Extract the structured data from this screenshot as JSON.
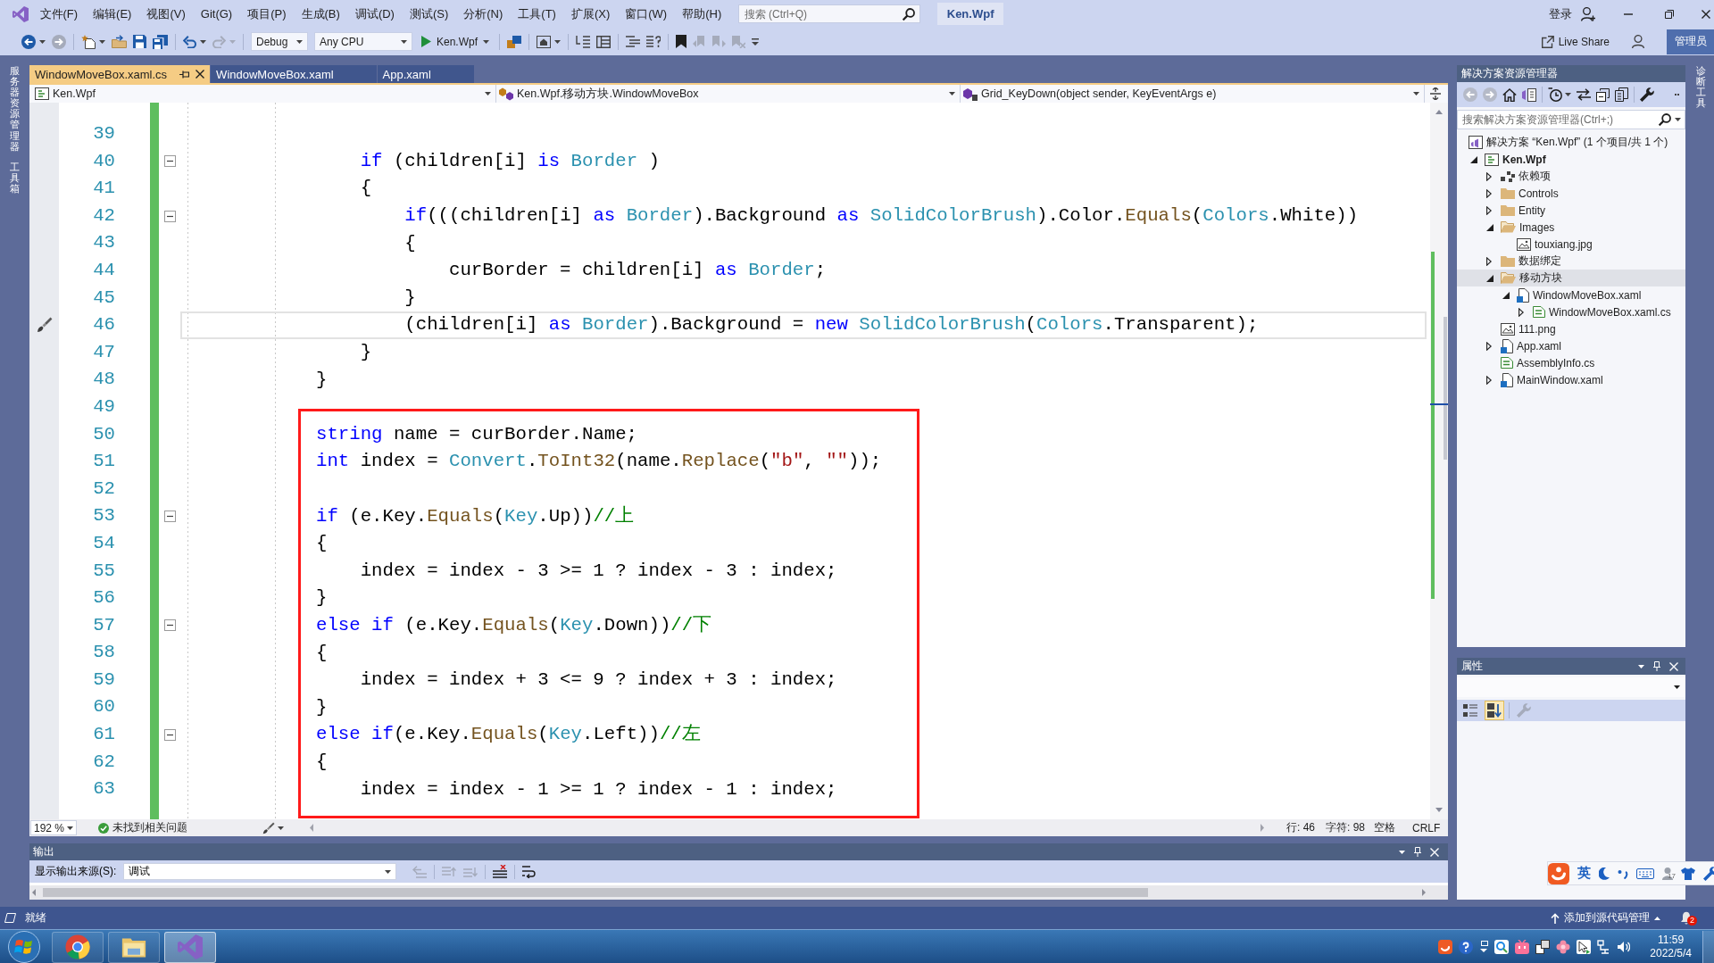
{
  "window": {
    "title": "Ken.Wpf",
    "sign_in": "登录",
    "search": {
      "placeholder": "搜索 (Ctrl+Q)"
    }
  },
  "menu": [
    "文件(F)",
    "编辑(E)",
    "视图(V)",
    "Git(G)",
    "项目(P)",
    "生成(B)",
    "调试(D)",
    "测试(S)",
    "分析(N)",
    "工具(T)",
    "扩展(X)",
    "窗口(W)",
    "帮助(H)"
  ],
  "toolbar": {
    "buttons": [
      {
        "kind": "back",
        "disabled": false
      },
      {
        "kind": "forward",
        "disabled": true
      },
      {
        "kind": "new-item",
        "disabled": false
      },
      {
        "kind": "open",
        "disabled": false
      },
      {
        "kind": "save",
        "disabled": false
      },
      {
        "kind": "save-all",
        "disabled": false
      },
      {
        "kind": "undo",
        "disabled": false
      },
      {
        "kind": "redo",
        "disabled": true
      }
    ],
    "configuration": "Debug",
    "platform": "Any CPU",
    "start": "Ken.Wpf",
    "tools": [
      {
        "kind": "browser-link",
        "disabled": false
      },
      {
        "kind": "window",
        "disabled": false
      },
      {
        "kind": "indent",
        "disabled": false
      },
      {
        "kind": "outdent",
        "disabled": false
      },
      {
        "kind": "comment",
        "disabled": false
      },
      {
        "kind": "uncomment",
        "disabled": false
      },
      {
        "kind": "bookmark",
        "disabled": false
      },
      {
        "kind": "bookmark-previous",
        "disabled": true
      },
      {
        "kind": "bookmark-next",
        "disabled": true
      },
      {
        "kind": "bookmark-clear",
        "disabled": true
      }
    ],
    "live_share": "Live Share",
    "account": "管理员"
  },
  "side_tabs": {
    "left": [
      "服务器资源管理器",
      "工具箱"
    ],
    "right": [
      "诊断工具"
    ]
  },
  "document_tabs": [
    {
      "label": "WindowMoveBox.xaml.cs",
      "selected": true
    },
    {
      "label": "WindowMoveBox.xaml",
      "selected": false
    },
    {
      "label": "App.xaml",
      "selected": false
    }
  ],
  "navigation": {
    "project": "Ken.Wpf",
    "type": "Ken.Wpf.移动方块.WindowMoveBox",
    "member": "Grid_KeyDown(object sender, KeyEventArgs e)"
  },
  "editor": {
    "lines": [
      {
        "number": "39",
        "current": false
      },
      {
        "number": "40",
        "current": false,
        "expanded": true,
        "tokens": [
          {
            "kind": "keyword",
            "text": "    if"
          },
          {
            "kind": "plain",
            "text": " (children[i] "
          },
          {
            "kind": "keyword",
            "text": "is "
          },
          {
            "kind": "type",
            "text": "Border"
          },
          {
            "kind": "plain",
            "text": " )"
          }
        ]
      },
      {
        "number": "41",
        "current": false,
        "tokens": [
          {
            "kind": "plain",
            "text": "    {"
          }
        ]
      },
      {
        "number": "42",
        "current": false,
        "expanded": true,
        "tokens": [
          {
            "kind": "keyword",
            "text": "        if"
          },
          {
            "kind": "plain",
            "text": "(((children[i] "
          },
          {
            "kind": "keyword",
            "text": "as "
          },
          {
            "kind": "type",
            "text": "Border"
          },
          {
            "kind": "plain",
            "text": ").Background "
          },
          {
            "kind": "keyword",
            "text": "as "
          },
          {
            "kind": "type",
            "text": "SolidColorBrush"
          },
          {
            "kind": "plain",
            "text": ").Color."
          },
          {
            "kind": "method",
            "text": "Equals"
          },
          {
            "kind": "plain",
            "text": "("
          },
          {
            "kind": "type",
            "text": "Colors"
          },
          {
            "kind": "plain",
            "text": ".White))"
          }
        ]
      },
      {
        "number": "43",
        "current": false,
        "tokens": [
          {
            "kind": "plain",
            "text": "        {"
          }
        ]
      },
      {
        "number": "44",
        "current": false,
        "tokens": [
          {
            "kind": "plain",
            "text": "            curBorder = children[i] "
          },
          {
            "kind": "keyword",
            "text": "as "
          },
          {
            "kind": "type",
            "text": "Border"
          },
          {
            "kind": "plain",
            "text": ";"
          }
        ]
      },
      {
        "number": "45",
        "current": false,
        "tokens": [
          {
            "kind": "plain",
            "text": "        }"
          }
        ]
      },
      {
        "number": "46",
        "current": true,
        "tokens": [
          {
            "kind": "plain",
            "text": "        (children[i] "
          },
          {
            "kind": "keyword",
            "text": "as "
          },
          {
            "kind": "type",
            "text": "Border"
          },
          {
            "kind": "plain",
            "text": ").Background = "
          },
          {
            "kind": "keyword",
            "text": "new "
          },
          {
            "kind": "type",
            "text": "SolidColorBrush"
          },
          {
            "kind": "plain",
            "text": "("
          },
          {
            "kind": "type",
            "text": "Colors"
          },
          {
            "kind": "plain",
            "text": ".Transparent);"
          }
        ]
      },
      {
        "number": "47",
        "current": false,
        "tokens": [
          {
            "kind": "plain",
            "text": "    }"
          }
        ]
      },
      {
        "number": "48",
        "current": false,
        "tokens": [
          {
            "kind": "plain",
            "text": "}"
          }
        ]
      },
      {
        "number": "49",
        "current": false
      },
      {
        "number": "50",
        "current": false,
        "tokens": [
          {
            "kind": "keyword",
            "text": "string"
          },
          {
            "kind": "plain",
            "text": " name = curBorder.Name;"
          }
        ]
      },
      {
        "number": "51",
        "current": false,
        "tokens": [
          {
            "kind": "keyword",
            "text": "int"
          },
          {
            "kind": "plain",
            "text": " index = "
          },
          {
            "kind": "type",
            "text": "Convert"
          },
          {
            "kind": "plain",
            "text": "."
          },
          {
            "kind": "method",
            "text": "ToInt32"
          },
          {
            "kind": "plain",
            "text": "(name."
          },
          {
            "kind": "method",
            "text": "Replace"
          },
          {
            "kind": "plain",
            "text": "("
          },
          {
            "kind": "string",
            "text": "\"b\""
          },
          {
            "kind": "plain",
            "text": ", "
          },
          {
            "kind": "string",
            "text": "\"\""
          },
          {
            "kind": "plain",
            "text": "));"
          }
        ]
      },
      {
        "number": "52",
        "current": false
      },
      {
        "number": "53",
        "current": false,
        "expanded": true,
        "tokens": [
          {
            "kind": "keyword",
            "text": "if"
          },
          {
            "kind": "plain",
            "text": " (e.Key."
          },
          {
            "kind": "method",
            "text": "Equals"
          },
          {
            "kind": "plain",
            "text": "("
          },
          {
            "kind": "type",
            "text": "Key"
          },
          {
            "kind": "plain",
            "text": ".Up))"
          },
          {
            "kind": "comment",
            "text": "//上"
          }
        ]
      },
      {
        "number": "54",
        "current": false,
        "tokens": [
          {
            "kind": "plain",
            "text": "{"
          }
        ]
      },
      {
        "number": "55",
        "current": false,
        "tokens": [
          {
            "kind": "plain",
            "text": "    index = index - 3 >= 1 ? index - 3 : index;"
          }
        ]
      },
      {
        "number": "56",
        "current": false,
        "tokens": [
          {
            "kind": "plain",
            "text": "}"
          }
        ]
      },
      {
        "number": "57",
        "current": false,
        "expanded": true,
        "tokens": [
          {
            "kind": "keyword",
            "text": "else if"
          },
          {
            "kind": "plain",
            "text": " (e.Key."
          },
          {
            "kind": "method",
            "text": "Equals"
          },
          {
            "kind": "plain",
            "text": "("
          },
          {
            "kind": "type",
            "text": "Key"
          },
          {
            "kind": "plain",
            "text": ".Down))"
          },
          {
            "kind": "comment",
            "text": "//下"
          }
        ]
      },
      {
        "number": "58",
        "current": false,
        "tokens": [
          {
            "kind": "plain",
            "text": "{"
          }
        ]
      },
      {
        "number": "59",
        "current": false,
        "tokens": [
          {
            "kind": "plain",
            "text": "    index = index + 3 <= 9 ? index + 3 : index;"
          }
        ]
      },
      {
        "number": "60",
        "current": false,
        "tokens": [
          {
            "kind": "plain",
            "text": "}"
          }
        ]
      },
      {
        "number": "61",
        "current": false,
        "expanded": true,
        "tokens": [
          {
            "kind": "keyword",
            "text": "else if"
          },
          {
            "kind": "plain",
            "text": "(e.Key."
          },
          {
            "kind": "method",
            "text": "Equals"
          },
          {
            "kind": "plain",
            "text": "("
          },
          {
            "kind": "type",
            "text": "Key"
          },
          {
            "kind": "plain",
            "text": ".Left))"
          },
          {
            "kind": "comment",
            "text": "//左"
          }
        ]
      },
      {
        "number": "62",
        "current": false,
        "tokens": [
          {
            "kind": "plain",
            "text": "{"
          }
        ]
      },
      {
        "number": "63",
        "current": false,
        "tokens": [
          {
            "kind": "plain",
            "text": "    index = index - 1 >= 1 ? index - 1 : index;"
          }
        ]
      }
    ],
    "zoom": "192 %",
    "issues": "未找到相关问题",
    "line": "行: 46",
    "column": "字符: 98",
    "indentation": "空格",
    "line_ending": "CRLF"
  },
  "output": {
    "title": "输出",
    "source_label": "显示输出来源(S):",
    "source": "调试",
    "buttons": [
      {
        "kind": "previous-message",
        "disabled": true
      },
      {
        "kind": "previous",
        "disabled": true
      },
      {
        "kind": "next",
        "disabled": true
      },
      {
        "kind": "clear-all",
        "disabled": false
      },
      {
        "kind": "word-wrap",
        "disabled": false
      }
    ]
  },
  "solution_explorer": {
    "title": "解决方案资源管理器",
    "toolbar": [
      {
        "kind": "back",
        "disabled": true
      },
      {
        "kind": "forward",
        "disabled": true
      },
      {
        "kind": "home",
        "disabled": false
      },
      {
        "kind": "switch-views",
        "disabled": false
      },
      {
        "kind": "history",
        "disabled": false
      },
      {
        "kind": "sync",
        "disabled": false
      },
      {
        "kind": "collapse-all",
        "disabled": false
      },
      {
        "kind": "show-all-files",
        "disabled": false
      },
      {
        "kind": "properties",
        "disabled": false
      }
    ],
    "search": {
      "placeholder": "搜索解决方案资源管理器(Ctrl+;)"
    },
    "tree": [
      {
        "label": "解决方案 “Ken.Wpf” (1 个项目/共 1 个)",
        "kind": "solution",
        "selected": false,
        "children": [
          {
            "label": "Ken.Wpf",
            "kind": "project",
            "selected": false,
            "expanded": true,
            "children": [
              {
                "label": "依赖项",
                "kind": "dependencies",
                "selected": false,
                "expanded": false
              },
              {
                "label": "Controls",
                "kind": "folder",
                "selected": false,
                "expanded": false
              },
              {
                "label": "Entity",
                "kind": "folder",
                "selected": false,
                "expanded": false
              },
              {
                "label": "Images",
                "kind": "folder",
                "selected": false,
                "expanded": true,
                "children": [
                  {
                    "label": "touxiang.jpg",
                    "kind": "image",
                    "selected": false
                  }
                ]
              },
              {
                "label": "数据绑定",
                "kind": "folder",
                "selected": false,
                "expanded": false
              },
              {
                "label": "移动方块",
                "kind": "folder",
                "selected": true,
                "expanded": true,
                "children": [
                  {
                    "label": "WindowMoveBox.xaml",
                    "kind": "xaml",
                    "selected": false,
                    "expanded": true,
                    "children": [
                      {
                        "label": "WindowMoveBox.xaml.cs",
                        "kind": "cs",
                        "selected": false,
                        "expanded": false
                      }
                    ]
                  }
                ]
              },
              {
                "label": "111.png",
                "kind": "image",
                "selected": false
              },
              {
                "label": "App.xaml",
                "kind": "xaml",
                "selected": false,
                "expanded": false
              },
              {
                "label": "AssemblyInfo.cs",
                "kind": "cs",
                "selected": false
              },
              {
                "label": "MainWindow.xaml",
                "kind": "xaml",
                "selected": false,
                "expanded": false
              }
            ]
          }
        ]
      }
    ]
  },
  "properties": {
    "title": "属性",
    "views": [
      {
        "kind": "categorized",
        "selected": false,
        "disabled": false
      },
      {
        "kind": "alphabetical",
        "selected": true,
        "disabled": false
      },
      {
        "kind": "property-pages",
        "selected": false,
        "disabled": true
      }
    ]
  },
  "ime": {
    "mode": "英",
    "badge": "17"
  },
  "status_bar": {
    "text": "就绪",
    "source_control": "添加到源代码管理",
    "notifications": "2"
  },
  "taskbar": {
    "apps": [
      {
        "kind": "browser",
        "selected": false
      },
      {
        "kind": "files",
        "selected": false
      },
      {
        "kind": "visual-studio",
        "selected": true
      }
    ],
    "time": "11:59",
    "date": "2022/5/4"
  }
}
